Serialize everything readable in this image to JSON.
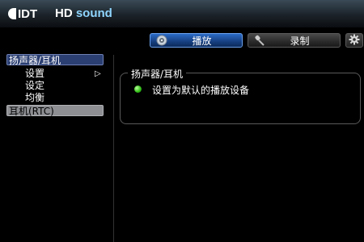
{
  "header": {
    "logo_text": "IDT",
    "title_hd": "HD",
    "title_sound": "sound"
  },
  "tabs": [
    {
      "label": "播放",
      "icon": "speaker-icon",
      "active": true
    },
    {
      "label": "录制",
      "icon": "microphone-icon",
      "active": false
    }
  ],
  "settings_icon": "gear-icon",
  "sidebar": {
    "device1": {
      "label": "扬声器/耳机",
      "items": [
        {
          "label": "设置",
          "selected": true
        },
        {
          "label": "设定"
        },
        {
          "label": "均衡"
        }
      ]
    },
    "arrow": "▷",
    "device2": {
      "label": "耳机(RTC)"
    }
  },
  "main": {
    "group_title": "扬声器/耳机",
    "default_label": "设置为默认的播放设备"
  },
  "colors": {
    "accent_blue": "#2c6cc8",
    "title_blue": "#8fd5ff",
    "status_green": "#37c21b"
  }
}
